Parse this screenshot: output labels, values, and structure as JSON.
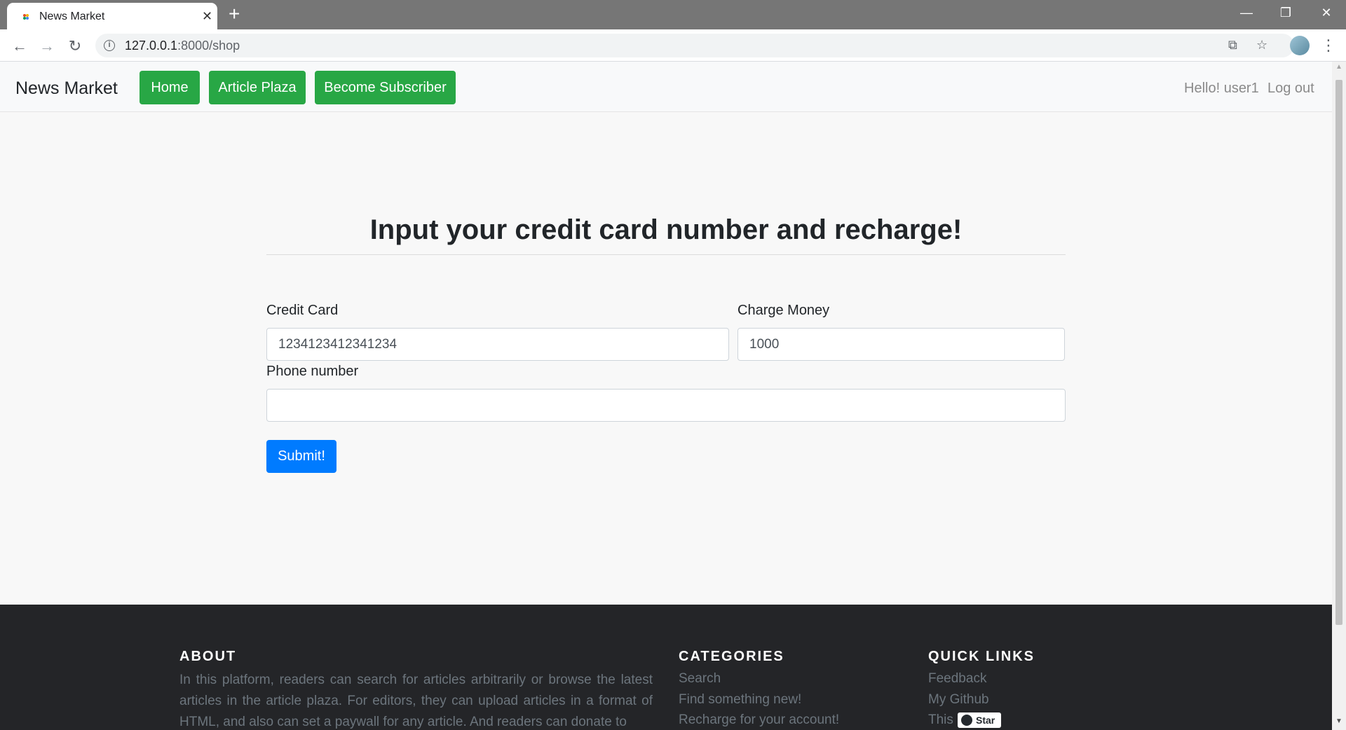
{
  "browser": {
    "tab_title": "News Market",
    "tab_close": "✕",
    "new_tab": "+",
    "url_host": "127.0.0.1",
    "url_path": ":8000/shop",
    "window_buttons": {
      "minimize": "—",
      "restore": "❐",
      "close": "✕"
    }
  },
  "navbar": {
    "brand": "News Market",
    "buttons": [
      "Home",
      "Article Plaza",
      "Become Subscriber"
    ],
    "greeting": "Hello! user1",
    "logout": "Log out"
  },
  "form": {
    "title": "Input your credit card number and recharge!",
    "credit_card_label": "Credit Card",
    "credit_card_value": "1234123412341234",
    "charge_label": "Charge Money",
    "charge_value": "1000",
    "phone_label": "Phone number",
    "phone_value": "",
    "submit_label": "Submit!"
  },
  "footer": {
    "about_heading": "ABOUT",
    "about_text": "In this platform, readers can search for articles arbitrarily or browse the latest articles in the article plaza. For editors, they can upload articles in a format of HTML, and also can set a paywall for any article. And readers can donate to",
    "categories_heading": "CATEGORIES",
    "categories": [
      "Search",
      "Find something new!",
      "Recharge for your account!"
    ],
    "quick_links_heading": "QUICK LINKS",
    "quick_links": [
      "Feedback",
      "My Github",
      "This"
    ],
    "star_label": "Star"
  },
  "colors": {
    "nav_button": "#28a745",
    "submit_button": "#007bff",
    "footer_bg": "#242528"
  }
}
